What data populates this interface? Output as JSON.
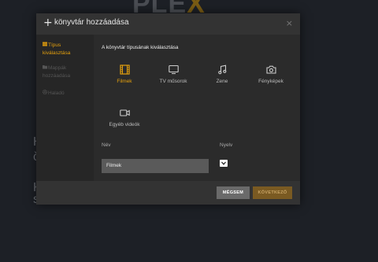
{
  "background": {
    "logo_main": "PLE",
    "logo_x": "X",
    "text_h": "H",
    "text_c": "č",
    "text_k": "K",
    "text_s": "s"
  },
  "dialog": {
    "plus": "+",
    "title": "könyvtár hozzáadása",
    "close": "×"
  },
  "sidebar": {
    "items": [
      {
        "label_line1": "Típus",
        "label_line2": "kiválasztása",
        "icon": "library-icon",
        "active": true
      },
      {
        "label_line1": "Mappák",
        "label_line2": "hozzáadása",
        "icon": "folder-icon",
        "active": false
      },
      {
        "label_line1": "Haladó",
        "label_line2": "",
        "icon": "gear-icon",
        "active": false
      }
    ]
  },
  "content": {
    "heading": "A könyvtár típusának kiválasztása",
    "types": [
      {
        "label": "Filmek",
        "icon": "film-icon",
        "selected": true
      },
      {
        "label": "TV műsorok",
        "icon": "tv-icon",
        "selected": false
      },
      {
        "label": "Zene",
        "icon": "music-icon",
        "selected": false
      },
      {
        "label": "Fényképek",
        "icon": "camera-icon",
        "selected": false
      },
      {
        "label": "Egyéb videók",
        "icon": "video-camera-icon",
        "selected": false
      }
    ],
    "name_label": "Név",
    "name_value": "Filmek",
    "language_label": "Nyelv"
  },
  "footer": {
    "cancel_label": "MÉGSEM",
    "next_label": "KÖVETKEZŐ"
  },
  "colors": {
    "accent": "#e5a00d",
    "modal_bg": "#2b2b2b",
    "sidebar_bg": "#262626"
  }
}
